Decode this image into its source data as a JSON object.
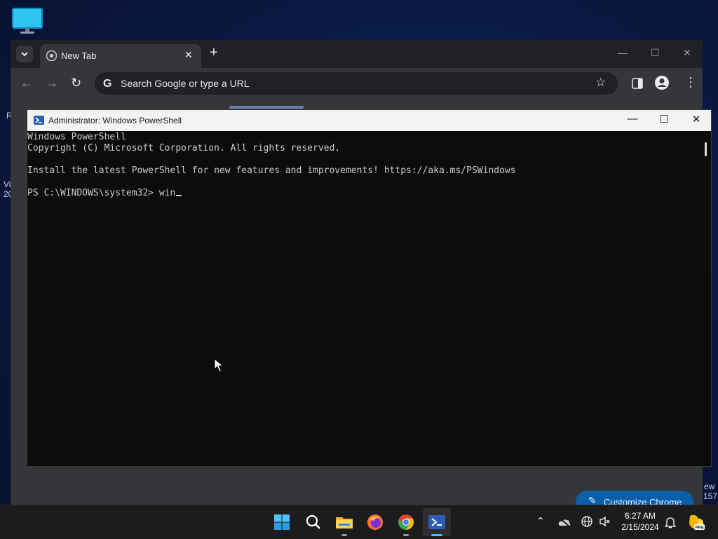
{
  "desktop": {
    "edge_text_left_top": "R",
    "edge_text_left_mid1": "Vi",
    "edge_text_left_mid2": "20",
    "edge_text_right1": "ew",
    "edge_text_right2": "157"
  },
  "chrome": {
    "tab_title": "New Tab",
    "tab_close": "✕",
    "new_tab": "+",
    "omnibox_placeholder": "Search Google or type a URL",
    "customize_label": "Customize Chrome",
    "accent": "#0b5ea8"
  },
  "powershell": {
    "title": "Administrator: Windows PowerShell",
    "lines": [
      "Windows PowerShell",
      "Copyright (C) Microsoft Corporation. All rights reserved.",
      "",
      "Install the latest PowerShell for new features and improvements! https://aka.ms/PSWindows",
      "",
      "PS C:\\WINDOWS\\system32> win"
    ]
  },
  "taskbar": {
    "apps": [
      "windows-start-icon",
      "search-icon",
      "file-explorer-icon",
      "firefox-icon",
      "chrome-icon",
      "powershell-icon"
    ],
    "time": "6:27 AM",
    "date": "2/15/2024"
  }
}
